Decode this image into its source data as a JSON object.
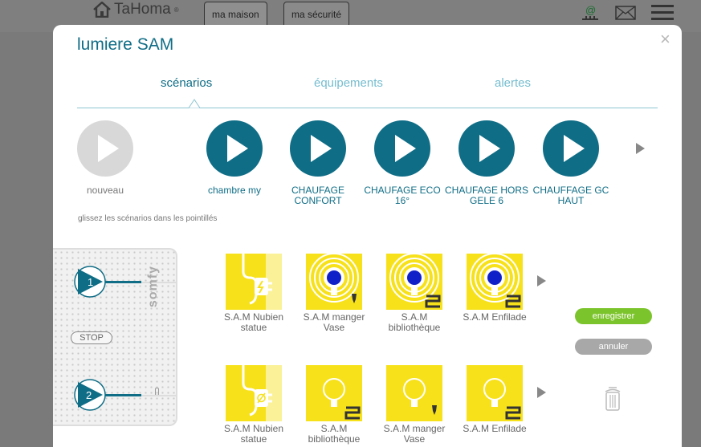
{
  "topbar": {
    "brand": "TaHoma",
    "brand_mark": "®",
    "tabs": [
      "ma maison",
      "ma sécurité"
    ],
    "icons": [
      "notification-icon",
      "mail-icon",
      "menu-icon"
    ]
  },
  "modal": {
    "title": "lumiere SAM",
    "close": "×",
    "tabs": [
      "scénarios",
      "équipements",
      "alertes"
    ],
    "active_tab": "scénarios"
  },
  "scenarios": {
    "new_label": "nouveau",
    "items": [
      {
        "label": "chambre my"
      },
      {
        "label": "CHAUFAGE CONFORT"
      },
      {
        "label": "CHAUFAGE ECO 16°"
      },
      {
        "label": "CHAUFAGE HORS GELE 6"
      },
      {
        "label": "CHAUFFAGE GC HAUT"
      }
    ]
  },
  "hint": "glissez les scénarios dans les pointillés",
  "remote": {
    "brand": "somfy",
    "button_1": "1",
    "button_2": "2",
    "stop_label": "STOP"
  },
  "devices": {
    "row1": [
      {
        "label": "S.A.M Nubien statue",
        "icon": "plug-on-icon"
      },
      {
        "label": "S.A.M manger Vase",
        "icon": "bulb-on-icon"
      },
      {
        "label": "S.A.M bibliothèque",
        "icon": "bulb-on-icon"
      },
      {
        "label": "S.A.M Enfilade",
        "icon": "bulb-on-icon"
      }
    ],
    "row2": [
      {
        "label": "S.A.M Nubien statue",
        "icon": "plug-off-icon"
      },
      {
        "label": "S.A.M bibliothèque",
        "icon": "bulb-off-icon"
      },
      {
        "label": "S.A.M manger Vase",
        "icon": "bulb-off-icon"
      },
      {
        "label": "S.A.M Enfilade",
        "icon": "bulb-off-icon"
      }
    ]
  },
  "actions": {
    "save": "enregistrer",
    "cancel": "annuler"
  },
  "colors": {
    "accent": "#0f6d86",
    "tile": "#f7e11b",
    "save": "#7cc42b",
    "lamp_on": "#1020c8"
  }
}
